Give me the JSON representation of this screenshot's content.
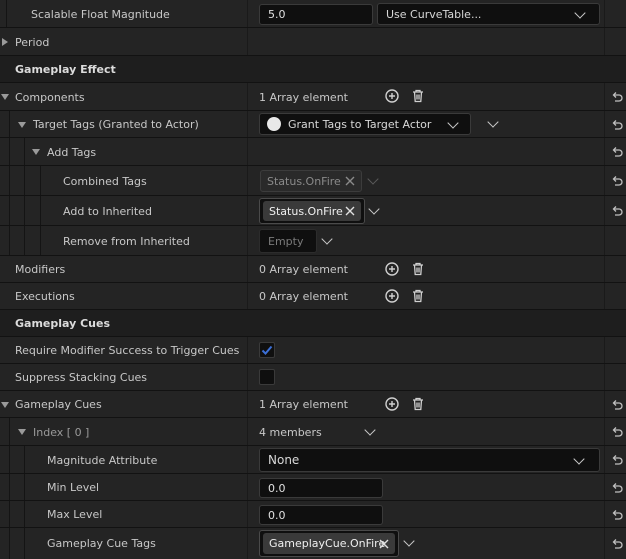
{
  "rows": {
    "scalable": {
      "label": "Scalable Float Magnitude",
      "value": "5.0",
      "curve": "Use CurveTable..."
    },
    "period": {
      "label": "Period"
    },
    "cat_effect": {
      "label": "Gameplay Effect"
    },
    "components": {
      "label": "Components",
      "value": "1 Array element"
    },
    "target_tags": {
      "label": "Target Tags (Granted to Actor)",
      "value": "Grant Tags to Target Actor"
    },
    "add_tags": {
      "label": "Add Tags"
    },
    "combined": {
      "label": "Combined Tags",
      "tag": "Status.OnFire"
    },
    "add_inherited": {
      "label": "Add to Inherited",
      "tag": "Status.OnFire"
    },
    "remove_inherited": {
      "label": "Remove from Inherited",
      "value": "Empty"
    },
    "modifiers": {
      "label": "Modifiers",
      "value": "0 Array element"
    },
    "executions": {
      "label": "Executions",
      "value": "0 Array element"
    },
    "cat_cues": {
      "label": "Gameplay Cues"
    },
    "require_mod": {
      "label": "Require Modifier Success to Trigger Cues",
      "checked": true
    },
    "suppress": {
      "label": "Suppress Stacking Cues",
      "checked": false
    },
    "gameplay_cues": {
      "label": "Gameplay Cues",
      "value": "1 Array element"
    },
    "index0": {
      "label": "Index [ 0 ]",
      "value": "4 members"
    },
    "magnitude_attr": {
      "label": "Magnitude Attribute",
      "value": "None"
    },
    "min_level": {
      "label": "Min Level",
      "value": "0.0"
    },
    "max_level": {
      "label": "Max Level",
      "value": "0.0"
    },
    "cue_tags": {
      "label": "Gameplay Cue Tags",
      "tag": "GameplayCue.OnFire"
    }
  },
  "colors": {
    "checkbox_accent": "#3b6fd6",
    "panel": "#242424",
    "category": "#1e1e1e",
    "field": "#0f0f0f"
  }
}
